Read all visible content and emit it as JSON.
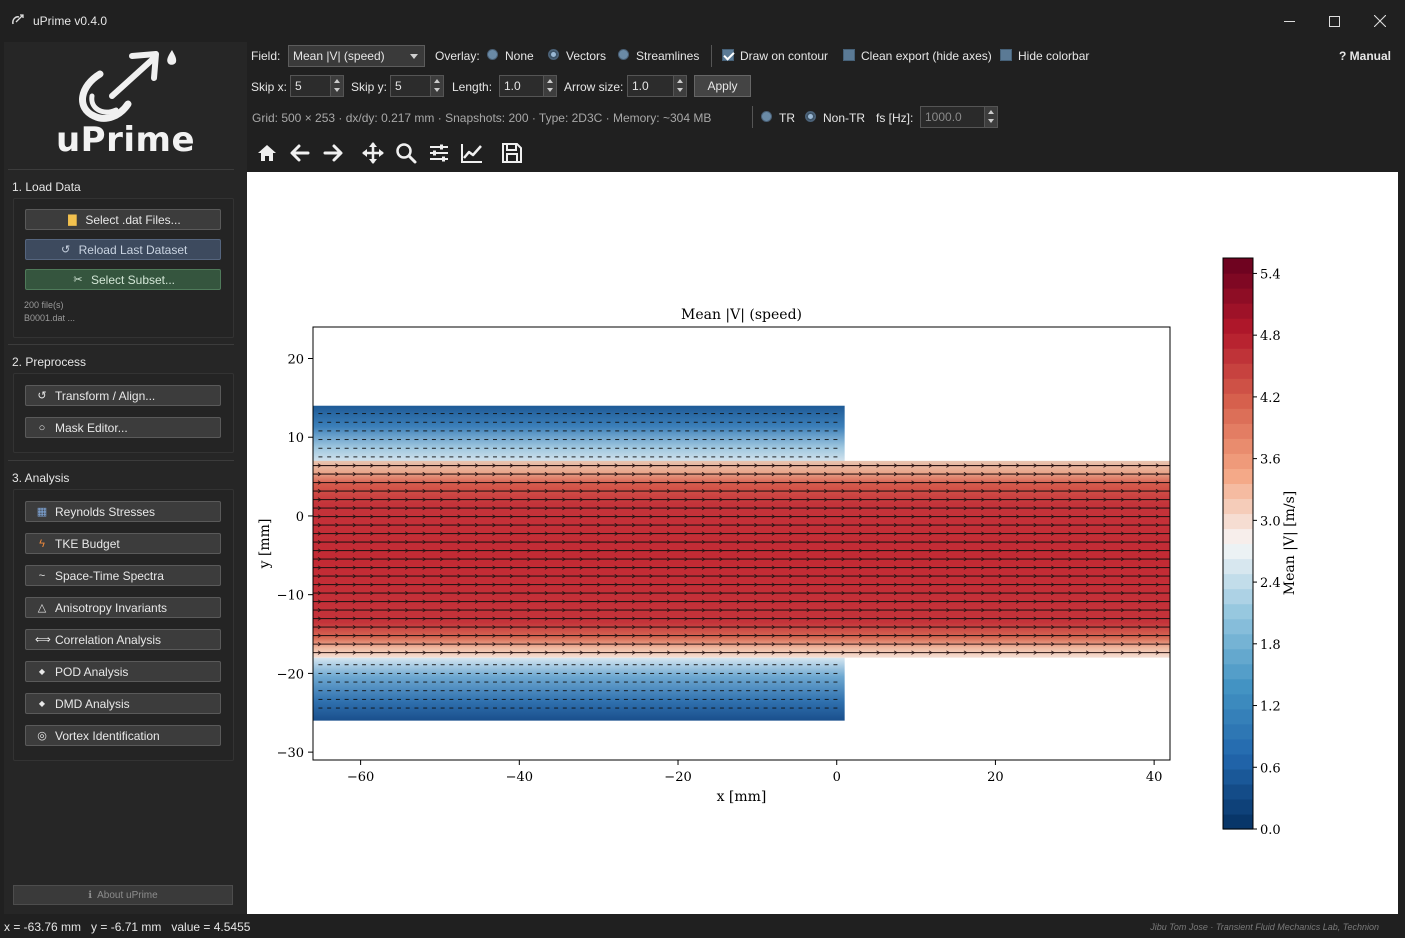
{
  "window": {
    "title": "uPrime v0.4.0"
  },
  "sidebar": {
    "brand": "uPrime",
    "sections": [
      {
        "title": "1. Load Data"
      },
      {
        "title": "2. Preprocess"
      },
      {
        "title": "3. Analysis"
      }
    ],
    "load": {
      "select_files": "Select .dat Files...",
      "reload": "Reload Last Dataset",
      "subset": "Select Subset...",
      "file_count": "200 file(s)",
      "first_file": "B0001.dat ..."
    },
    "preprocess": [
      {
        "label": "Transform / Align...",
        "icon": "refresh-icon"
      },
      {
        "label": "Mask Editor...",
        "icon": "circle-icon"
      }
    ],
    "analysis": [
      {
        "label": "Reynolds Stresses",
        "icon": "chart-icon"
      },
      {
        "label": "TKE Budget",
        "icon": "bolt-icon"
      },
      {
        "label": "Space-Time Spectra",
        "icon": "wave-icon"
      },
      {
        "label": "Anisotropy Invariants",
        "icon": "triangle-icon"
      },
      {
        "label": "Correlation Analysis",
        "icon": "double-arrow-icon"
      },
      {
        "label": "POD Analysis",
        "icon": "diamond-icon"
      },
      {
        "label": "DMD Analysis",
        "icon": "diamond-icon"
      },
      {
        "label": "Vortex Identification",
        "icon": "target-icon"
      }
    ],
    "about": "About uPrime"
  },
  "controls": {
    "field_label": "Field:",
    "field_value": "Mean |V| (speed)",
    "overlay_label": "Overlay:",
    "overlay_options": [
      "None",
      "Vectors",
      "Streamlines"
    ],
    "overlay_selected": "Vectors",
    "draw_on_contour": "Draw on contour",
    "draw_on_contour_checked": true,
    "clean_export": "Clean export (hide axes)",
    "clean_export_checked": false,
    "hide_colorbar": "Hide colorbar",
    "hide_colorbar_checked": false,
    "manual": "? Manual",
    "skip_x_label": "Skip x:",
    "skip_x": "5",
    "skip_y_label": "Skip y:",
    "skip_y": "5",
    "length_label": "Length:",
    "length": "1.0",
    "arrow_size_label": "Arrow size:",
    "arrow_size": "1.0",
    "apply": "Apply",
    "info": "Grid: 500 × 253 · dx/dy: 0.217 mm · Snapshots: 200 · Type: 2D3C · Memory: ~304 MB",
    "tr": "TR",
    "non_tr": "Non-TR",
    "tr_selected": "Non-TR",
    "fs_label": "fs [Hz]:",
    "fs_value": "1000.0"
  },
  "toolbar": [
    "home-icon",
    "back-icon",
    "forward-icon",
    "pan-icon",
    "zoom-icon",
    "configure-icon",
    "axes-icon",
    "save-icon"
  ],
  "chart_data": {
    "type": "heatmap",
    "title": "Mean |V| (speed)",
    "xlabel": "x [mm]",
    "ylabel": "y [mm]",
    "xlim": [
      -66,
      42
    ],
    "ylim": [
      -31,
      24
    ],
    "x_ticks": [
      -60,
      -40,
      -20,
      0,
      20,
      40
    ],
    "x_tick_labels": [
      "−60",
      "−40",
      "−20",
      "0",
      "20",
      "40"
    ],
    "y_ticks": [
      20,
      10,
      0,
      -10,
      -20,
      -30
    ],
    "y_tick_labels": [
      "20",
      "10",
      "0",
      "−10",
      "−20",
      "−30"
    ],
    "colorbar": {
      "label": "Mean |V| [m/s]",
      "range": [
        0.0,
        5.55
      ],
      "ticks": [
        0.0,
        0.6,
        1.2,
        1.8,
        2.4,
        3.0,
        3.6,
        4.2,
        4.8,
        5.4
      ],
      "tick_labels": [
        "0.0",
        "0.6",
        "1.2",
        "1.8",
        "2.4",
        "3.0",
        "3.6",
        "4.2",
        "4.8",
        "5.4"
      ],
      "colormap": "RdBu_r"
    },
    "regions": {
      "upper_lowspeed": {
        "x": [
          -66,
          1
        ],
        "y": [
          6.5,
          14
        ]
      },
      "jet_core": {
        "x": [
          -66,
          42
        ],
        "y": [
          -18,
          7
        ]
      },
      "lower_lowspeed": {
        "x": [
          -66,
          1
        ],
        "y": [
          -26,
          -18
        ]
      }
    },
    "overlay": "vectors"
  },
  "status": {
    "cursor": "x = -63.76 mm   y = -6.71 mm   value = 4.5455",
    "credit": "Jibu Tom Jose · Transient Fluid Mechanics Lab, Technion"
  }
}
